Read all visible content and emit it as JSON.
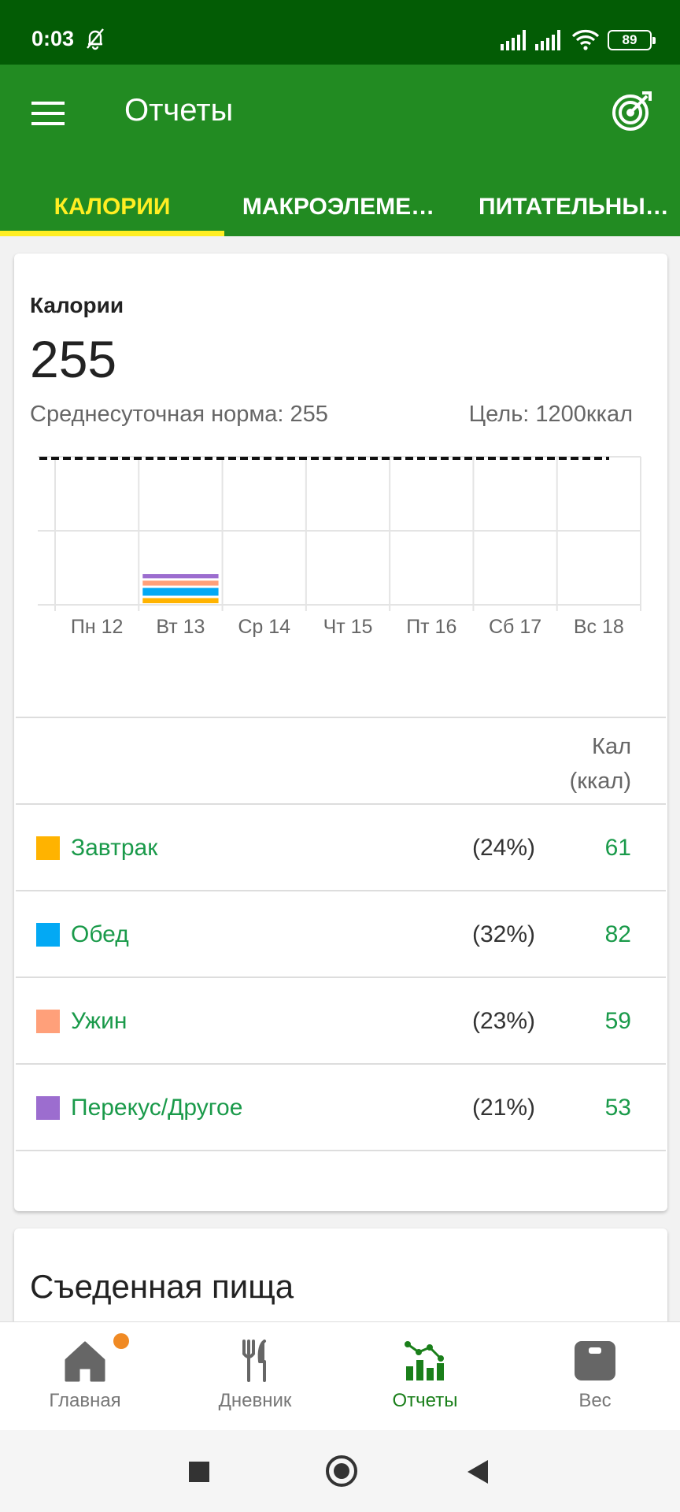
{
  "status": {
    "time": "0:03",
    "battery": "89"
  },
  "appbar": {
    "title": "Отчеты"
  },
  "tabs": [
    {
      "label": "КАЛОРИИ",
      "active": true
    },
    {
      "label": "МАКРОЭЛЕМЕ…"
    },
    {
      "label": "ПИТАТЕЛЬНЫЕ…"
    }
  ],
  "summary": {
    "label": "Калории",
    "value": "255",
    "average": "Среднесуточная норма: 255",
    "goal": "Цель: 1200ккал"
  },
  "colors": {
    "breakfast": "#ffb300",
    "lunch": "#03a9f4",
    "dinner": "#ffa07a",
    "snack": "#9c6dcf",
    "accent": "#228b22"
  },
  "chart_data": {
    "type": "bar",
    "categories": [
      "Пн 12",
      "Вт 13",
      "Ср 14",
      "Чт 15",
      "Пт 16",
      "Сб 17",
      "Вс 18"
    ],
    "series": [
      {
        "name": "Завтрак",
        "values": [
          0,
          61,
          0,
          0,
          0,
          0,
          0
        ]
      },
      {
        "name": "Обед",
        "values": [
          0,
          82,
          0,
          0,
          0,
          0,
          0
        ]
      },
      {
        "name": "Ужин",
        "values": [
          0,
          59,
          0,
          0,
          0,
          0,
          0
        ]
      },
      {
        "name": "Перекус/Другое",
        "values": [
          0,
          53,
          0,
          0,
          0,
          0,
          0
        ]
      }
    ],
    "goal_line": 1200,
    "stacked": true,
    "grid": true,
    "ylim": [
      0,
      1200
    ]
  },
  "table": {
    "unit_label_1": "Кал",
    "unit_label_2": "(ккал)",
    "rows": [
      {
        "name": "Завтрак",
        "percent": "(24%)",
        "kcal": "61",
        "color_key": "breakfast"
      },
      {
        "name": "Обед",
        "percent": "(32%)",
        "kcal": "82",
        "color_key": "lunch"
      },
      {
        "name": "Ужин",
        "percent": "(23%)",
        "kcal": "59",
        "color_key": "dinner"
      },
      {
        "name": "Перекус/Другое",
        "percent": "(21%)",
        "kcal": "53",
        "color_key": "snack"
      }
    ]
  },
  "eaten": {
    "title": "Съеденная пища"
  },
  "bottom_nav": [
    {
      "label": "Главная",
      "icon": "home-icon"
    },
    {
      "label": "Дневник",
      "icon": "fork-knife-icon"
    },
    {
      "label": "Отчеты",
      "icon": "chart-icon",
      "active": true
    },
    {
      "label": "Вес",
      "icon": "scale-icon"
    }
  ]
}
